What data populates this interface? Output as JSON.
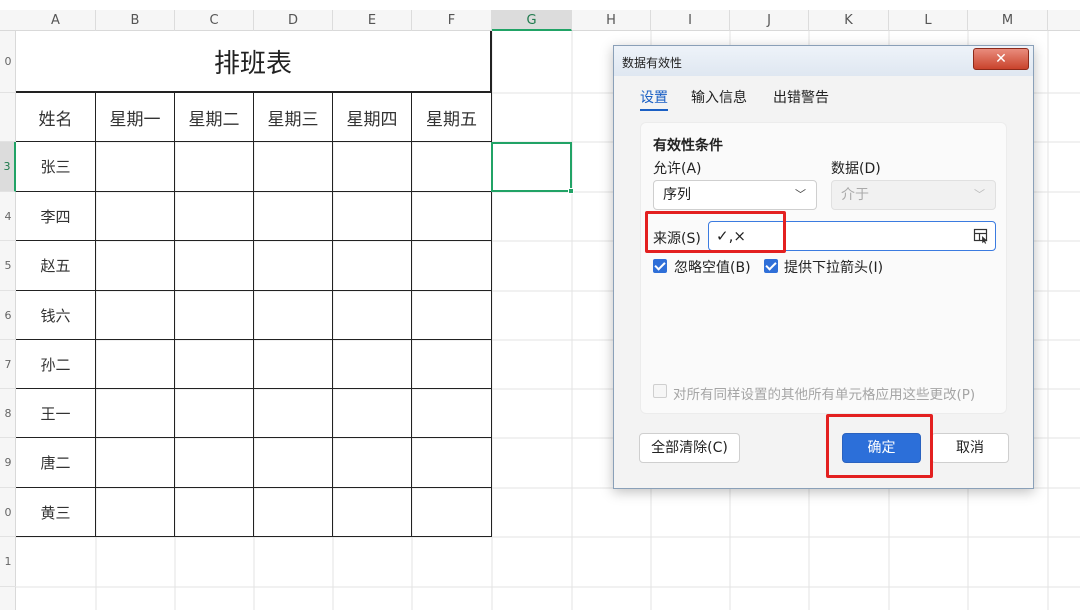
{
  "sheet": {
    "columns": [
      "A",
      "B",
      "C",
      "D",
      "E",
      "F",
      "G",
      "H",
      "I",
      "J",
      "K",
      "L",
      "M"
    ],
    "selected_column": "G",
    "rows": [
      "0",
      "",
      "3",
      "4",
      "5",
      "6",
      "7",
      "8",
      "9",
      "0",
      "1"
    ],
    "schedule": {
      "title": "排班表",
      "headers": [
        "姓名",
        "星期一",
        "星期二",
        "星期三",
        "星期四",
        "星期五"
      ],
      "names": [
        "张三",
        "李四",
        "赵五",
        "钱六",
        "孙二",
        "王一",
        "唐二",
        "黄三"
      ]
    }
  },
  "dialog": {
    "title": "数据有效性",
    "close_label": "✕",
    "tabs": [
      {
        "label": "设置",
        "active": true
      },
      {
        "label": "输入信息",
        "active": false
      },
      {
        "label": "出错警告",
        "active": false
      }
    ],
    "section_title": "有效性条件",
    "allow": {
      "label": "允许(A)",
      "value": "序列"
    },
    "data": {
      "label": "数据(D)",
      "value": "介于"
    },
    "source": {
      "label": "来源(S)",
      "value": "✓,×"
    },
    "ignore_blank": {
      "label": "忽略空值(B)",
      "checked": true
    },
    "dropdown": {
      "label": "提供下拉箭头(I)",
      "checked": true
    },
    "apply_all": {
      "label": "对所有同样设置的其他所有单元格应用这些更改(P)",
      "checked": false
    },
    "buttons": {
      "clear_all": "全部清除(C)",
      "ok": "确定",
      "cancel": "取消"
    }
  },
  "colors": {
    "highlight": "#e32020",
    "primary": "#2c6fd9",
    "selection": "#21a366"
  }
}
